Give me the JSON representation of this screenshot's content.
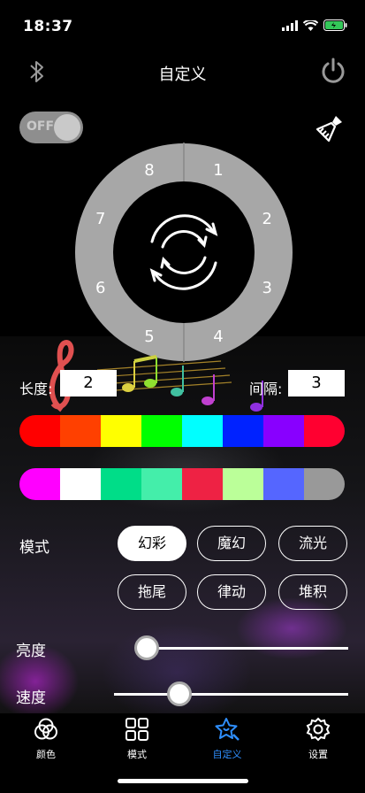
{
  "status": {
    "time": "18:37"
  },
  "header": {
    "title": "自定义",
    "left_icon": "bluetooth-icon",
    "right_icon": "power-icon"
  },
  "toggle": {
    "label": "OFF",
    "state": "off"
  },
  "wheel": {
    "segments": [
      "1",
      "2",
      "3",
      "4",
      "5",
      "6",
      "7",
      "8"
    ],
    "center_icon": "refresh-cycle-icon"
  },
  "length": {
    "label": "长度:",
    "value": "2"
  },
  "interval": {
    "label": "间隔:",
    "value": "3"
  },
  "strip1": {
    "colors": [
      "#ff0000",
      "#ff4000",
      "#ffff00",
      "#00ff00",
      "#00ffff",
      "#0022ff",
      "#8800ff",
      "#ff0030"
    ]
  },
  "strip2": {
    "colors": [
      "#ff00ff",
      "#ffffff",
      "#00dd88",
      "#44eeaa",
      "#ee2244",
      "#bbff99",
      "#5566ff",
      "#999999"
    ]
  },
  "mode": {
    "label": "模式",
    "options": [
      "幻彩",
      "魔幻",
      "流光",
      "拖尾",
      "律动",
      "堆积"
    ],
    "active": "幻彩"
  },
  "brightness": {
    "label": "亮度",
    "value": 0.0
  },
  "speed": {
    "label": "速度",
    "value": 0.28
  },
  "tabs": [
    {
      "label": "颜色",
      "icon": "color-circles-icon"
    },
    {
      "label": "模式",
      "icon": "grid-icon"
    },
    {
      "label": "自定义",
      "icon": "star-edit-icon",
      "active": true,
      "color": "#2f8fff"
    },
    {
      "label": "设置",
      "icon": "gear-icon"
    }
  ]
}
